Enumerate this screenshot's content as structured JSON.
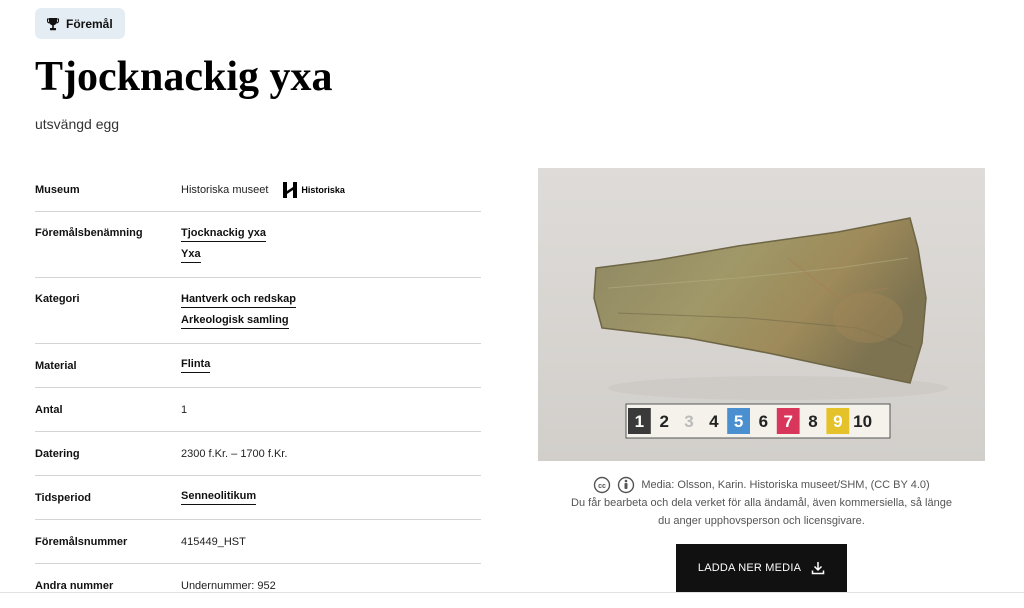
{
  "badge": {
    "label": "Föremål",
    "icon": "trophy-icon"
  },
  "object": {
    "title": "Tjocknackig yxa",
    "subtitle": "utsvängd egg"
  },
  "properties": {
    "museum": {
      "label": "Museum",
      "value": "Historiska museet",
      "logo_text": "Historiska"
    },
    "name": {
      "label": "Föremålsbenämning",
      "links": [
        "Tjocknackig yxa",
        "Yxa"
      ]
    },
    "category": {
      "label": "Kategori",
      "links": [
        "Hantverk och redskap",
        "Arkeologisk samling"
      ]
    },
    "material": {
      "label": "Material",
      "link": "Flinta"
    },
    "count": {
      "label": "Antal",
      "value": "1"
    },
    "dating": {
      "label": "Datering",
      "value": "2300 f.Kr. – 1700 f.Kr."
    },
    "period": {
      "label": "Tidsperiod",
      "link": "Senneolitikum"
    },
    "object_number": {
      "label": "Föremålsnummer",
      "value": "415449_HST"
    },
    "other_numbers": {
      "label": "Andra nummer",
      "value": "Undernummer: 952"
    }
  },
  "media": {
    "scale_numbers": [
      "1",
      "2",
      "3",
      "4",
      "5",
      "6",
      "7",
      "8",
      "9",
      "10"
    ],
    "credit": "Media: Olsson, Karin. Historiska museet/SHM, (CC BY 4.0)",
    "license_line1": "Du får bearbeta och dela verket för alla ändamål, även kommersiella, så länge",
    "license_line2": "du anger upphovsperson och licensgivare.",
    "download_label": "LADDA NER MEDIA"
  },
  "colors": {
    "badge_bg": "#e5edf4",
    "button_bg": "#111111",
    "photo_bg": "#dcd9d6"
  }
}
